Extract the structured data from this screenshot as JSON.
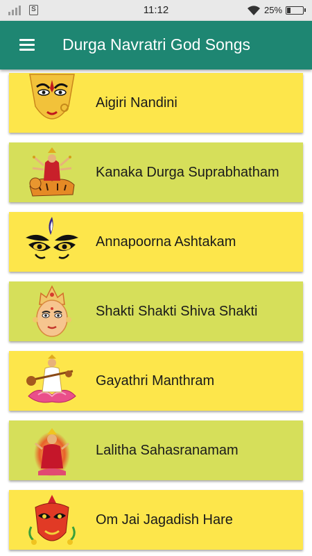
{
  "status_bar": {
    "time": "11:12",
    "sim_glyph": "S",
    "battery_percent": "25%",
    "battery_level": 0.25,
    "icons": [
      "signal-icon",
      "sim-icon",
      "wifi-icon",
      "battery-icon"
    ]
  },
  "app_bar": {
    "title": "Durga Navratri God Songs",
    "menu_icon": "hamburger-menu-icon",
    "color": "#1e8672"
  },
  "songs": [
    {
      "title": "Aigiri Nandini",
      "color": "#fde64b",
      "thumbnail": "durga-face-icon"
    },
    {
      "title": "Kanaka Durga Suprabhatham",
      "color": "#d6df5a",
      "thumbnail": "durga-on-tiger-icon"
    },
    {
      "title": "Annapoorna Ashtakam",
      "color": "#fde64b",
      "thumbnail": "goddess-eyes-icon"
    },
    {
      "title": "Shakti Shakti Shiva Shakti",
      "color": "#d6df5a",
      "thumbnail": "goddess-face-crown-icon"
    },
    {
      "title": "Gayathri Manthram",
      "color": "#fde64b",
      "thumbnail": "saraswati-veena-icon"
    },
    {
      "title": "Lalitha Sahasranamam",
      "color": "#d6df5a",
      "thumbnail": "lalitha-devi-icon"
    },
    {
      "title": "Om Jai Jagadish Hare",
      "color": "#fde64b",
      "thumbnail": "durga-mask-icon"
    }
  ]
}
